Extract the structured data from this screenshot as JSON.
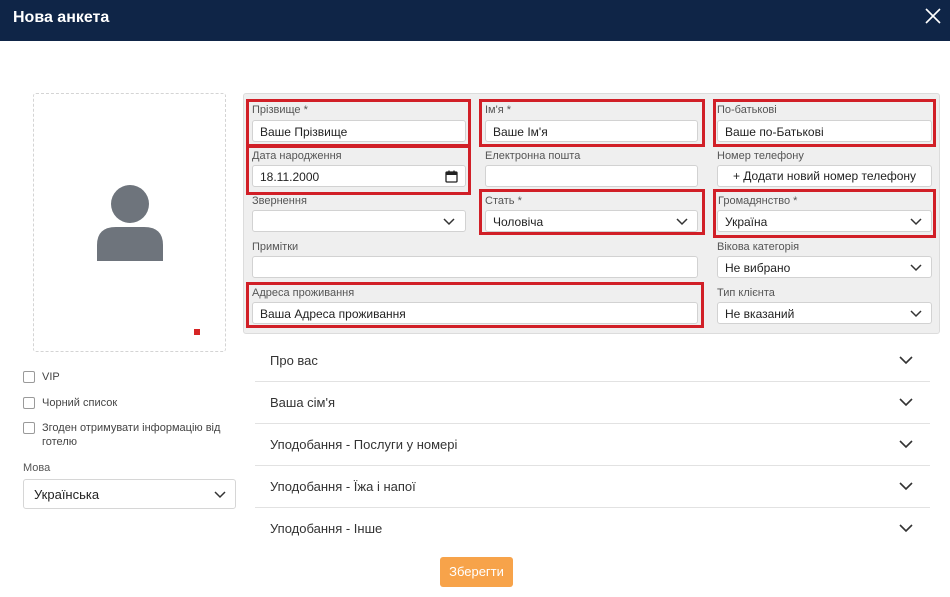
{
  "window": {
    "title": "Нова анкета"
  },
  "colors": {
    "header": "#0f2547",
    "highlight": "#d11f27",
    "save_button": "#f7a34a",
    "panel": "#efefef"
  },
  "icons": {
    "close": "close-icon",
    "avatar": "user-avatar-icon",
    "dropdown": "chevron-down-icon",
    "calendar": "calendar-icon"
  },
  "left": {
    "checkboxes": [
      {
        "label": "VIP"
      },
      {
        "label": "Чорний список"
      },
      {
        "label": "Згоден отримувати інформацію від готелю"
      }
    ],
    "language": {
      "label": "Мова",
      "value": "Українська"
    }
  },
  "form": {
    "surname": {
      "label": "Прізвище",
      "required": "*",
      "value": "Ваше Прізвище"
    },
    "first_name": {
      "label": "Ім'я",
      "required": "*",
      "value": "Ваше Ім'я"
    },
    "patronymic": {
      "label": "По-батькові",
      "value": "Ваше по-Батькові"
    },
    "birth_date": {
      "label": "Дата народження",
      "value": "18.11.2000"
    },
    "email": {
      "label": "Електронна пошта",
      "value": ""
    },
    "phone": {
      "label": "Номер телефону",
      "add_label": "+ Додати новий номер телефону"
    },
    "salutation": {
      "label": "Звернення",
      "value": ""
    },
    "gender": {
      "label": "Стать",
      "required": "*",
      "value": "Чоловіча"
    },
    "citizenship": {
      "label": "Громадянство",
      "required": "*",
      "value": "Україна"
    },
    "notes": {
      "label": "Примітки",
      "value": ""
    },
    "age_category": {
      "label": "Вікова категорія",
      "value": "Не вибрано"
    },
    "address": {
      "label": "Адреса проживання",
      "value": "Ваша Адреса проживання"
    },
    "client_type": {
      "label": "Тип клієнта",
      "value": "Не вказаний"
    }
  },
  "sections": [
    {
      "title": "Про вас"
    },
    {
      "title": "Ваша сім'я"
    },
    {
      "title": "Уподобання - Послуги у номері"
    },
    {
      "title": "Уподобання - Їжа і напої"
    },
    {
      "title": "Уподобання - Інше"
    }
  ],
  "actions": {
    "save": "Зберегти"
  }
}
